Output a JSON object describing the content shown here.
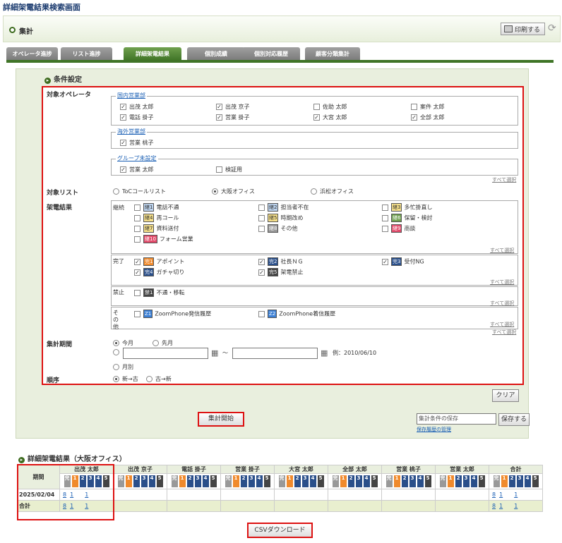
{
  "page_title": "詳細架電結果検索画面",
  "header": {
    "title": "集計",
    "print_label": "印刷する"
  },
  "tabs": [
    "オペレータ進捗",
    "リスト進捗",
    "詳細架電結果",
    "個別成績",
    "個別対応履歴",
    "顧客分類集計"
  ],
  "conditions": {
    "title": "条件設定",
    "operator_label": "対象オペレータ",
    "groups": [
      {
        "name": "国内営業部",
        "members": [
          {
            "n": "出茂 太郎",
            "c": true
          },
          {
            "n": "出茂 京子",
            "c": true
          },
          {
            "n": "佐助 太郎",
            "c": false
          },
          {
            "n": "案件 太郎",
            "c": false
          },
          {
            "n": "電話 掛子",
            "c": true
          },
          {
            "n": "営業 掛子",
            "c": true
          },
          {
            "n": "大宮 太郎",
            "c": true
          },
          {
            "n": "全部 太郎",
            "c": true
          }
        ]
      },
      {
        "name": "海外営業部",
        "members": [
          {
            "n": "営業 桃子",
            "c": true
          }
        ]
      },
      {
        "name": "グループ未設定",
        "members": [
          {
            "n": "営業 太郎",
            "c": true
          },
          {
            "n": "検証用",
            "c": false
          }
        ]
      }
    ],
    "select_all": "すべて選択",
    "list_label": "対象リスト",
    "lists": [
      {
        "n": "ToCコールリスト",
        "on": false
      },
      {
        "n": "大阪オフィス",
        "on": true
      },
      {
        "n": "浜松オフィス",
        "on": false
      }
    ],
    "result_label": "架電結果",
    "cont_label": "継続",
    "cont": [
      {
        "b": "継1",
        "n": "電話不通",
        "col": "#bcd3ee",
        "c": false
      },
      {
        "b": "継2",
        "n": "担当者不在",
        "col": "#bcd3ee",
        "c": false
      },
      {
        "b": "継3",
        "n": "多忙掛直し",
        "col": "#f6e08a",
        "c": false
      },
      {
        "b": "継4",
        "n": "再コール",
        "col": "#f6e08a",
        "c": false
      },
      {
        "b": "継5",
        "n": "時期改め",
        "col": "#f6e08a",
        "c": false
      },
      {
        "b": "継6",
        "n": "保留・検討",
        "col": "#6fa04e",
        "c": false
      },
      {
        "b": "継7",
        "n": "資料送付",
        "col": "#f6e08a",
        "c": false
      },
      {
        "b": "継8",
        "n": "その他",
        "col": "#999",
        "c": false
      },
      {
        "b": "継9",
        "n": "商談",
        "col": "#e24a6a",
        "c": false
      },
      {
        "b": "継10",
        "n": "フォーム営業",
        "col": "#e24a6a",
        "c": false
      }
    ],
    "done_label": "完了",
    "done": [
      {
        "b": "完1",
        "n": "アポイント",
        "col": "#f08a2c",
        "c": true
      },
      {
        "b": "完2",
        "n": "社長ＮＧ",
        "col": "#2a4f8a",
        "c": true
      },
      {
        "b": "完3",
        "n": "受付NG",
        "col": "#2a4f8a",
        "c": true
      },
      {
        "b": "完4",
        "n": "ガチャ切り",
        "col": "#2a4f8a",
        "c": true
      },
      {
        "b": "完5",
        "n": "架電禁止",
        "col": "#444",
        "c": true
      }
    ],
    "ban_label": "禁止",
    "ban": [
      {
        "b": "禁1",
        "n": "不通・移転",
        "col": "#444",
        "c": false
      }
    ],
    "other_label": "その他",
    "other": [
      {
        "b": "Z1",
        "n": "ZoomPhone発信履歴",
        "col": "#3a7fd5",
        "c": false
      },
      {
        "b": "Z2",
        "n": "ZoomPhone着信履歴",
        "col": "#3a7fd5",
        "c": false
      }
    ],
    "period_label": "集計期間",
    "period_this": "今月",
    "period_prev": "先月",
    "period_month": "月別",
    "date_sep": "〜",
    "date_example": "例：2010/06/10",
    "order_label": "順序",
    "order_new": "新→古",
    "order_old": "古→新",
    "clear": "クリア",
    "start": "集計開始",
    "save_placeholder": "集計条件の保存",
    "save": "保存する",
    "save_history": "保存履歴の管理"
  },
  "results": {
    "title": "詳細架電結果（大阪オフィス）",
    "period_header": "期間",
    "operators": [
      "出茂 太郎",
      "出茂 京子",
      "電話 掛子",
      "営業 掛子",
      "大宮 太郎",
      "全部 太郎",
      "営業 桃子",
      "営業 太郎",
      "合計"
    ],
    "rows": [
      {
        "label": "2025/02/04",
        "vals": [
          "8",
          "1",
          "1"
        ],
        "total": [
          "8",
          "1",
          "1"
        ]
      },
      {
        "label": "合計",
        "vals": [
          "8",
          "1",
          "1"
        ],
        "total": [
          "8",
          "1",
          "1"
        ]
      }
    ],
    "csv": "CSVダウンロード"
  }
}
